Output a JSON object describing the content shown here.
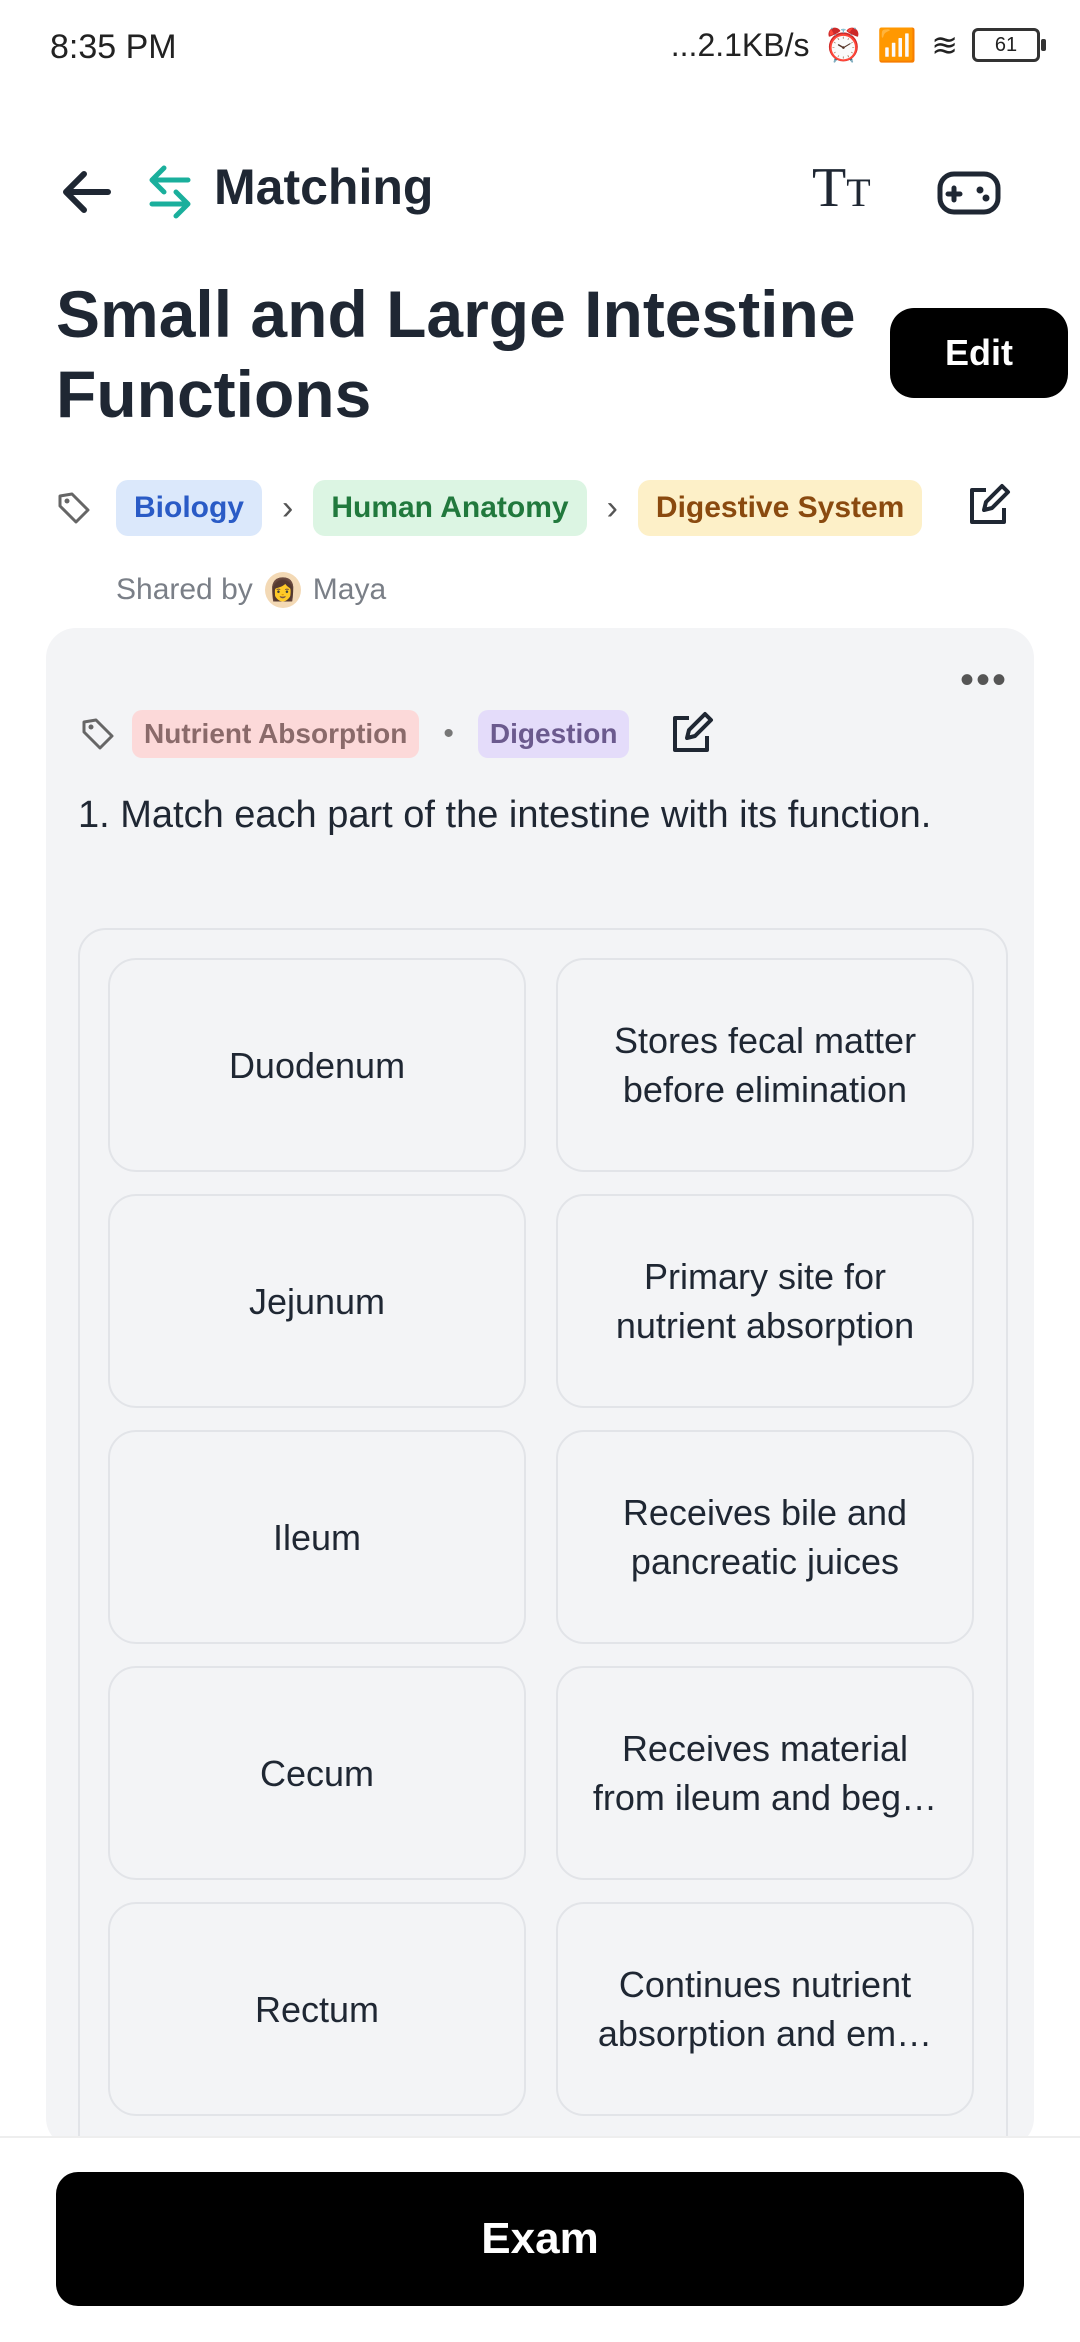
{
  "status": {
    "time": "8:35 PM",
    "network": "...2.1KB/s",
    "battery": "61"
  },
  "header": {
    "title": "Matching",
    "text_size_label": "T",
    "text_size_small": "T"
  },
  "page": {
    "title": "Small and Large Intestine Functions",
    "edit_label": "Edit"
  },
  "breadcrumb": [
    {
      "label": "Biology",
      "bg": "#dbe8fb",
      "fg": "#2a5bc6"
    },
    {
      "label": "Human Anatomy",
      "bg": "#dcf5e3",
      "fg": "#21793d"
    },
    {
      "label": "Digestive System",
      "bg": "#fdf0c8",
      "fg": "#8a4a0f"
    }
  ],
  "shared": {
    "prefix": "Shared by",
    "user": "Maya"
  },
  "card": {
    "more_label": "•••",
    "tags": [
      {
        "label": "Nutrient Absorption",
        "bg": "#fcd9d9",
        "fg": "#8a6a6a"
      },
      {
        "label": "Digestion",
        "bg": "#e4dcfa",
        "fg": "#6b5a8e"
      }
    ],
    "dot": "•",
    "question": "1. Match each part of the intestine with its function.",
    "left": [
      "Duodenum",
      "Jejunum",
      "Ileum",
      "Cecum",
      "Rectum"
    ],
    "right": [
      "Stores fecal matter before elimination",
      "Primary site for nutrient absorption",
      "Receives bile and pancreatic juices",
      "Receives material from ileum and beg…",
      "Continues nutrient absorption and em…"
    ]
  },
  "footer": {
    "exam_label": "Exam"
  }
}
